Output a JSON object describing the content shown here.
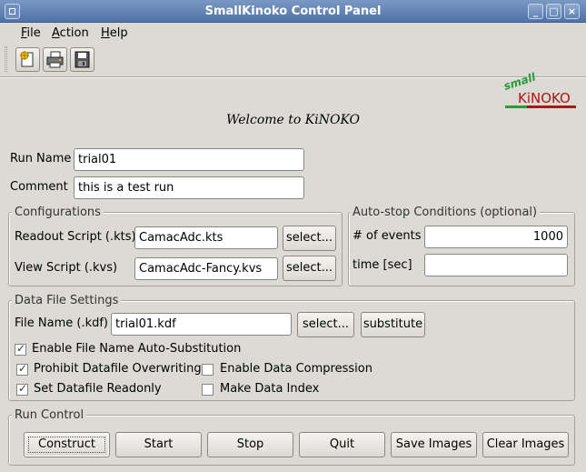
{
  "window": {
    "title": "SmallKinoko Control Panel",
    "controls": {
      "minimize": "_",
      "maximize": "□",
      "close": "×"
    }
  },
  "menubar": {
    "items": [
      {
        "underline": "F",
        "rest": "ile"
      },
      {
        "underline": "A",
        "rest": "ction"
      },
      {
        "underline": "H",
        "rest": "elp"
      }
    ]
  },
  "toolbar": {
    "icons": [
      "new-document-icon",
      "print-icon",
      "save-disk-icon"
    ]
  },
  "logo": {
    "small": "small",
    "main": "KiNOKO",
    "colors": {
      "small": "#2a9a3a",
      "main": "#b31414"
    }
  },
  "welcome": "Welcome to KiNOKO",
  "run_name": {
    "label": "Run Name",
    "value": "trial01"
  },
  "comment": {
    "label": "Comment",
    "value": "this is a test run"
  },
  "configurations": {
    "title": "Configurations",
    "readout": {
      "label": "Readout Script (.kts)",
      "value": "CamacAdc.kts",
      "button": "select..."
    },
    "view": {
      "label": "View Script (.kvs)",
      "value": "CamacAdc-Fancy.kvs",
      "button": "select..."
    }
  },
  "autostop": {
    "title": "Auto-stop Conditions (optional)",
    "events": {
      "label": "# of events",
      "value": "1000"
    },
    "time": {
      "label": "time [sec]",
      "value": ""
    }
  },
  "datafile": {
    "title": "Data File Settings",
    "filename": {
      "label": "File Name (.kdf)",
      "value": "trial01.kdf",
      "select_button": "select...",
      "substitute_button": "substitute"
    },
    "checkboxes": {
      "auto_substitution": {
        "label": "Enable File Name Auto-Substitution",
        "checked": true
      },
      "prohibit_overwrite": {
        "label": "Prohibit Datafile Overwriting",
        "checked": true
      },
      "compression": {
        "label": "Enable Data Compression",
        "checked": false
      },
      "readonly": {
        "label": "Set Datafile Readonly",
        "checked": true
      },
      "index": {
        "label": "Make Data Index",
        "checked": false
      }
    }
  },
  "run_control": {
    "title": "Run Control",
    "buttons": {
      "construct": "Construct",
      "start": "Start",
      "stop": "Stop",
      "quit": "Quit",
      "save_images": "Save Images",
      "clear_images": "Clear Images"
    }
  },
  "check_glyph": "✓"
}
